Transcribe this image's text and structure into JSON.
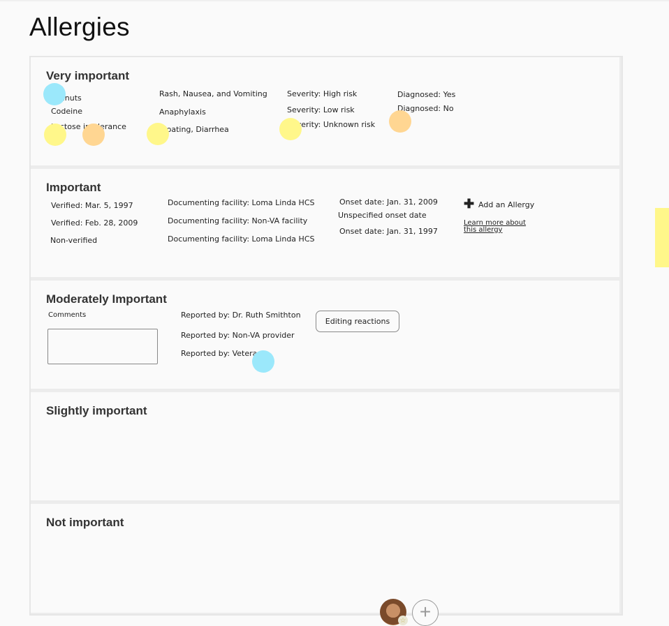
{
  "page": {
    "title": "Allergies"
  },
  "sections": {
    "very_important": {
      "title": "Very important",
      "allergens": [
        "Peanuts",
        "Codeine",
        "Lactose intolerance"
      ],
      "reactions": [
        "Rash, Nausea, and Vomiting",
        "Anaphylaxis",
        "Bloating, Diarrhea"
      ],
      "severity": [
        "Severity: High risk",
        "Severity: Low risk",
        "Severity: Unknown risk"
      ],
      "diagnosed": [
        "Diagnosed: Yes",
        "Diagnosed: No"
      ]
    },
    "important": {
      "title": "Important",
      "verified": [
        "Verified: Mar. 5, 1997",
        "Verified: Feb. 28, 2009",
        "Non-verified"
      ],
      "facility": [
        "Documenting facility: Loma Linda HCS",
        "Documenting facility: Non-VA facility",
        "Documenting facility: Loma Linda HCS"
      ],
      "onset": [
        "Onset date: Jan. 31, 2009",
        "Unspecified onset date",
        "Onset date: Jan. 31, 1997"
      ],
      "add_allergy_label": "Add an Allergy",
      "learn_more_label": "Learn more about this allergy"
    },
    "moderately_important": {
      "title": "Moderately Important",
      "comments_label": "Comments",
      "comments_value": "",
      "reported_by": [
        "Reported by: Dr. Ruth Smithton",
        "Reported by: Non-VA provider",
        "Reported by: Veteran"
      ],
      "editing_button_label": "Editing reactions"
    },
    "slightly_important": {
      "title": "Slightly important"
    },
    "not_important": {
      "title": "Not important"
    }
  },
  "footer": {
    "add_symbol": "+",
    "badge_symbol": "☆"
  },
  "colors": {
    "dot_blue": "#9be8fb",
    "dot_yellow": "#fff78a",
    "dot_orange": "#ffd692",
    "section_bg": "#fafafa",
    "divider": "#ececec"
  },
  "icons": {
    "add_allergy": "plus-icon",
    "add_participant": "plus-circle-icon",
    "badge": "star-icon"
  }
}
